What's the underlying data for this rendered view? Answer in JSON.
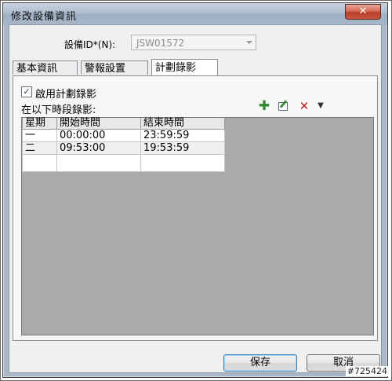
{
  "window": {
    "title": "修改設備資訊",
    "close_symbol": "✕"
  },
  "device": {
    "label": "設備ID*(N):",
    "value": "JSW01572"
  },
  "tabs": [
    {
      "label": "基本資訊",
      "active": false
    },
    {
      "label": "警報設置",
      "active": false
    },
    {
      "label": "計劃錄影",
      "active": true
    }
  ],
  "schedule": {
    "enable_label": "啟用計劃錄影",
    "enabled": true,
    "section_label": "在以下時段錄影:",
    "toolbar": {
      "add_icon": "add-icon",
      "edit_icon": "edit-icon",
      "delete_icon": "delete-icon",
      "dropdown_icon": "chevron-down-icon"
    },
    "columns": [
      "星期",
      "開始時間",
      "結束時間"
    ],
    "rows": [
      [
        "一",
        "00:00:00",
        "23:59:59"
      ],
      [
        "二",
        "09:53:00",
        "19:53:59"
      ]
    ]
  },
  "buttons": {
    "save": "保存",
    "cancel": "取消"
  },
  "watermark": "#725424",
  "colors": {
    "title_bar": "#aebdce",
    "close_button": "#c9563f",
    "grid_background": "#aaaaaa",
    "add_icon": "#2f8a2f",
    "delete_icon": "#c02020"
  }
}
